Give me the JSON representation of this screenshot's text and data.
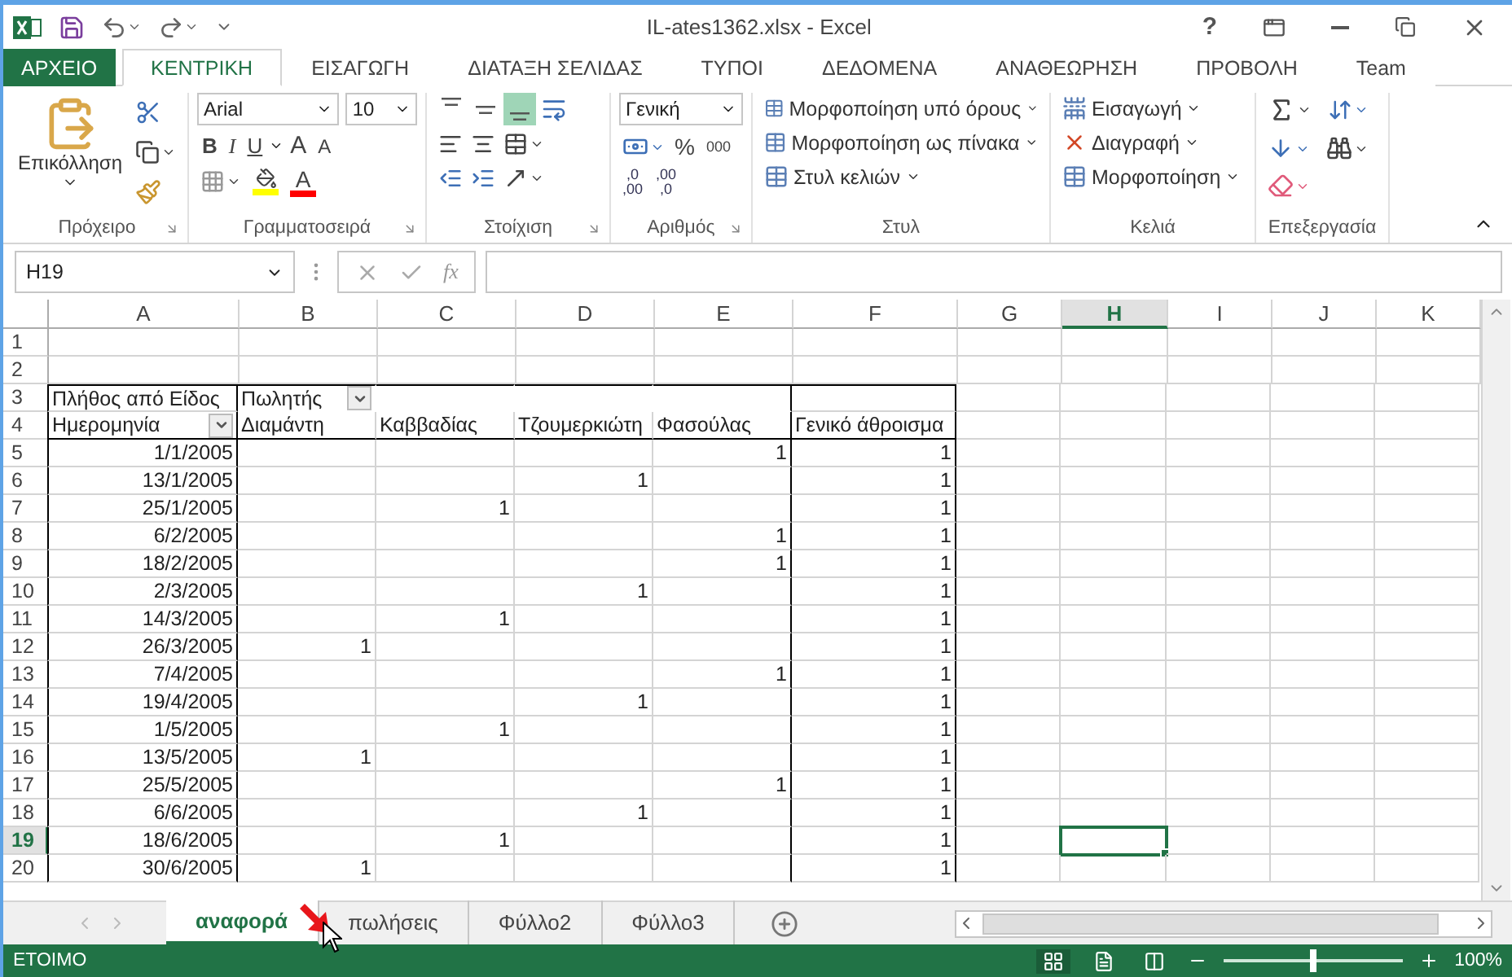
{
  "window": {
    "title": "IL-ates1362.xlsx - Excel",
    "help": "?"
  },
  "ribbon_tabs": [
    {
      "label": "ΑΡΧΕΙΟ",
      "kind": "file",
      "selected": false
    },
    {
      "label": "ΚΕΝΤΡΙΚΗ",
      "kind": "tab",
      "selected": true
    },
    {
      "label": "ΕΙΣΑΓΩΓΗ",
      "kind": "tab",
      "selected": false
    },
    {
      "label": "ΔΙΑΤΑΞΗ ΣΕΛΙΔΑΣ",
      "kind": "tab",
      "selected": false
    },
    {
      "label": "ΤΥΠΟΙ",
      "kind": "tab",
      "selected": false
    },
    {
      "label": "ΔΕΔΟΜΕΝΑ",
      "kind": "tab",
      "selected": false
    },
    {
      "label": "ΑΝΑΘΕΩΡΗΣΗ",
      "kind": "tab",
      "selected": false
    },
    {
      "label": "ΠΡΟΒΟΛΗ",
      "kind": "tab",
      "selected": false
    },
    {
      "label": "Team",
      "kind": "tab",
      "selected": false
    }
  ],
  "ribbon": {
    "clipboard": {
      "title": "Πρόχειρο",
      "paste": "Επικόλληση"
    },
    "font": {
      "title": "Γραμματοσειρά",
      "font_name": "Arial",
      "font_size": "10",
      "styles": [
        "B",
        "I",
        "U"
      ],
      "grow": "A",
      "shrink": "A",
      "font_color_label": "A"
    },
    "alignment": {
      "title": "Στοίχιση",
      "vertical": [
        {
          "kind": "top",
          "selected": false
        },
        {
          "kind": "middle",
          "selected": false
        },
        {
          "kind": "bottom",
          "selected": true
        }
      ]
    },
    "number": {
      "title": "Αριθμός",
      "format": "Γενική",
      "percent": "%",
      "thousands": "000",
      "decimals": [
        {
          "top": ",0",
          "bottom": ",00"
        },
        {
          "top": ",00",
          "bottom": ",0"
        }
      ]
    },
    "styles": {
      "title": "Στυλ",
      "items": [
        "Μορφοποίηση υπό όρους",
        "Μορφοποίηση ως πίνακα",
        "Στυλ κελιών"
      ]
    },
    "cells": {
      "title": "Κελιά",
      "items": [
        "Εισαγωγή",
        "Διαγραφή",
        "Μορφοποίηση"
      ]
    },
    "editing": {
      "title": "Επεξεργασία"
    }
  },
  "formula_bar": {
    "name_box": "H19",
    "fx": "fx"
  },
  "sheet": {
    "columns": [
      {
        "label": "A",
        "selected": false
      },
      {
        "label": "B",
        "selected": false
      },
      {
        "label": "C",
        "selected": false
      },
      {
        "label": "D",
        "selected": false
      },
      {
        "label": "E",
        "selected": false
      },
      {
        "label": "F",
        "selected": false
      },
      {
        "label": "G",
        "selected": false
      },
      {
        "label": "H",
        "selected": true
      },
      {
        "label": "I",
        "selected": false
      },
      {
        "label": "J",
        "selected": false
      },
      {
        "label": "K",
        "selected": false
      }
    ],
    "rows": [
      {
        "number": "1",
        "kind": "blank",
        "selected": false
      },
      {
        "number": "2",
        "kind": "blank",
        "selected": false
      },
      {
        "number": "3",
        "kind": "pivot_title",
        "selected": false,
        "cells": [
          {
            "text": "Πλήθος από Είδος",
            "filter": false
          },
          {
            "text": "Πωλητής",
            "filter": true
          }
        ]
      },
      {
        "number": "4",
        "kind": "pivot_fields",
        "selected": false,
        "cells": [
          {
            "text": "Ημερομηνία",
            "filter": true
          },
          {
            "text": "Διαμάντη",
            "filter": false
          },
          {
            "text": "Καββαδίας",
            "filter": false
          },
          {
            "text": "Τζουμερκιώτη",
            "filter": false
          },
          {
            "text": "Φασούλας",
            "filter": false
          },
          {
            "text": "Γενικό άθροισμα",
            "filter": false
          }
        ]
      },
      {
        "number": "5",
        "kind": "data",
        "selected": false,
        "cells": [
          "1/1/2005",
          null,
          null,
          null,
          "1",
          "1"
        ]
      },
      {
        "number": "6",
        "kind": "data",
        "selected": false,
        "cells": [
          "13/1/2005",
          null,
          null,
          "1",
          null,
          "1"
        ]
      },
      {
        "number": "7",
        "kind": "data",
        "selected": false,
        "cells": [
          "25/1/2005",
          null,
          "1",
          null,
          null,
          "1"
        ]
      },
      {
        "number": "8",
        "kind": "data",
        "selected": false,
        "cells": [
          "6/2/2005",
          null,
          null,
          null,
          "1",
          "1"
        ]
      },
      {
        "number": "9",
        "kind": "data",
        "selected": false,
        "cells": [
          "18/2/2005",
          null,
          null,
          null,
          "1",
          "1"
        ]
      },
      {
        "number": "10",
        "kind": "data",
        "selected": false,
        "cells": [
          "2/3/2005",
          null,
          null,
          "1",
          null,
          "1"
        ]
      },
      {
        "number": "11",
        "kind": "data",
        "selected": false,
        "cells": [
          "14/3/2005",
          null,
          "1",
          null,
          null,
          "1"
        ]
      },
      {
        "number": "12",
        "kind": "data",
        "selected": false,
        "cells": [
          "26/3/2005",
          "1",
          null,
          null,
          null,
          "1"
        ]
      },
      {
        "number": "13",
        "kind": "data",
        "selected": false,
        "cells": [
          "7/4/2005",
          null,
          null,
          null,
          "1",
          "1"
        ]
      },
      {
        "number": "14",
        "kind": "data",
        "selected": false,
        "cells": [
          "19/4/2005",
          null,
          null,
          "1",
          null,
          "1"
        ]
      },
      {
        "number": "15",
        "kind": "data",
        "selected": false,
        "cells": [
          "1/5/2005",
          null,
          "1",
          null,
          null,
          "1"
        ]
      },
      {
        "number": "16",
        "kind": "data",
        "selected": false,
        "cells": [
          "13/5/2005",
          "1",
          null,
          null,
          null,
          "1"
        ]
      },
      {
        "number": "17",
        "kind": "data",
        "selected": false,
        "cells": [
          "25/5/2005",
          null,
          null,
          null,
          "1",
          "1"
        ]
      },
      {
        "number": "18",
        "kind": "data",
        "selected": false,
        "cells": [
          "6/6/2005",
          null,
          null,
          "1",
          null,
          "1"
        ]
      },
      {
        "number": "19",
        "kind": "data",
        "selected": true,
        "cells": [
          "18/6/2005",
          null,
          "1",
          null,
          null,
          "1"
        ]
      },
      {
        "number": "20",
        "kind": "data",
        "selected": false,
        "cells": [
          "30/6/2005",
          "1",
          null,
          null,
          null,
          "1"
        ]
      }
    ]
  },
  "sheet_tabs": [
    {
      "label": "αναφορά",
      "selected": true
    },
    {
      "label": "πωλήσεις",
      "selected": false
    },
    {
      "label": "Φύλλο2",
      "selected": false
    },
    {
      "label": "Φύλλο3",
      "selected": false
    }
  ],
  "status_bar": {
    "status": "ΕΤΟΙΜΟ",
    "views": [
      {
        "kind": "normal",
        "selected": true
      },
      {
        "kind": "page_layout",
        "selected": false
      },
      {
        "kind": "page_break",
        "selected": false
      }
    ],
    "zoom": {
      "level": 0.5,
      "reading": "100%"
    }
  }
}
